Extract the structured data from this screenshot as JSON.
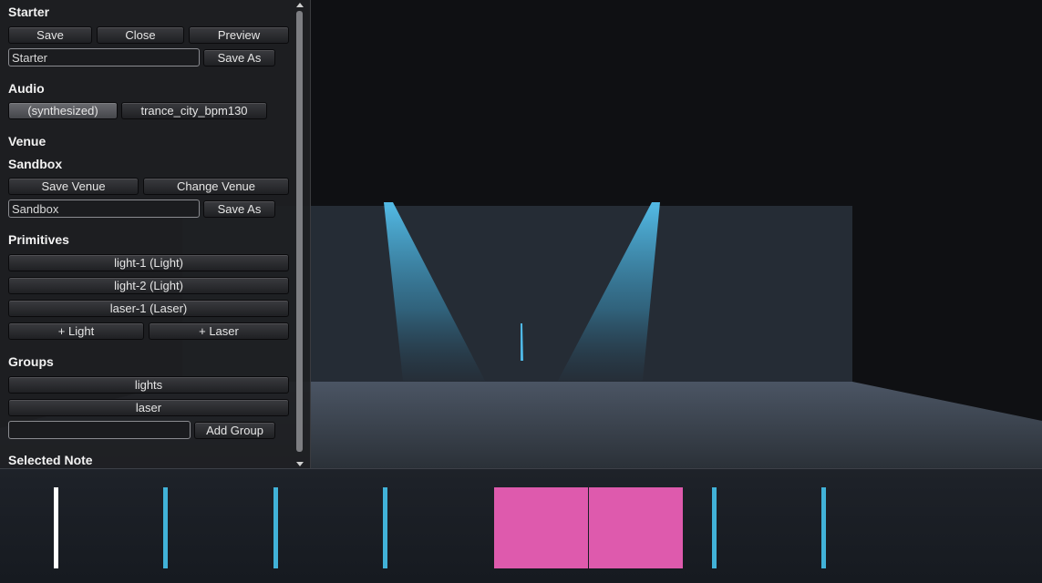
{
  "project": {
    "title": "Starter",
    "save_label": "Save",
    "close_label": "Close",
    "preview_label": "Preview",
    "name_value": "Starter",
    "save_as_label": "Save As"
  },
  "audio": {
    "title": "Audio",
    "tracks": [
      "(synthesized)",
      "trance_city_bpm130"
    ],
    "selected": "(synthesized)"
  },
  "venue": {
    "title": "Venue",
    "name": "Sandbox",
    "save_label": "Save Venue",
    "change_label": "Change Venue",
    "name_value": "Sandbox",
    "save_as_label": "Save As"
  },
  "primitives": {
    "title": "Primitives",
    "items": [
      "light-1 (Light)",
      "light-2 (Light)",
      "laser-1 (Laser)"
    ],
    "add_light_label": "+ Light",
    "add_laser_label": "+ Laser"
  },
  "groups": {
    "title": "Groups",
    "items": [
      "lights",
      "laser"
    ],
    "new_group_value": "",
    "add_label": "Add Group"
  },
  "selected_note": {
    "title": "Selected Note"
  },
  "colors": {
    "panel_bg": "#1e1f22",
    "beam": "#4fb8e6",
    "beat_marker": "#41b2d8",
    "playhead": "#ffffff",
    "note": "#de5aad"
  },
  "timeline": {
    "playhead_index": 0,
    "beat_markers": 7,
    "notes": 2
  }
}
